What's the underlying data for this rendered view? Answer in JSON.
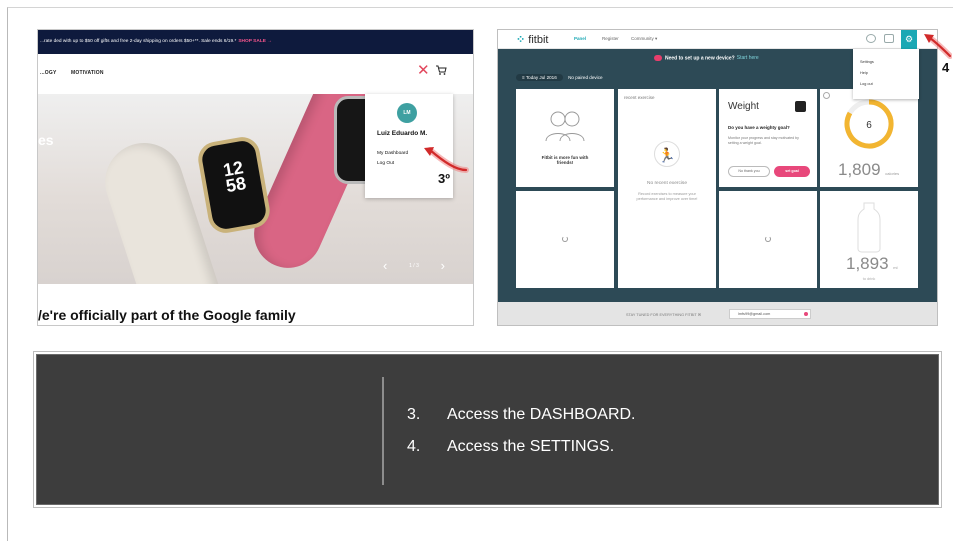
{
  "left_screenshot": {
    "promo_text": "...rate ded with up to $50 off gifts and free 2-day shipping on orders $50+**. Sale ends 6/19.*",
    "promo_link": "SHOP SALE →",
    "nav_items": [
      "...OGY",
      "MOTIVATION"
    ],
    "hero_text": "es",
    "watch_time": "12\n58",
    "carousel_pager": "1 / 3",
    "user_menu": {
      "avatar_initials": "LM",
      "user_name": "Luiz Eduardo M.",
      "links": [
        "My Dashboard",
        "Log Out"
      ]
    },
    "headline": "/e're officially part of the Google family",
    "step_marker": "3º"
  },
  "right_screenshot": {
    "logo": "fitbit",
    "tabs": [
      "Panel",
      "Register",
      "Community ▾"
    ],
    "banner_text": "Need to set up a new device?",
    "banner_link": "Start here",
    "today_label": "Today",
    "today_date": "Jul 2016",
    "paired_label": "No paired device",
    "friends_caption": "Fitbit is more fun with friends!",
    "exercise_title": "recent exercise",
    "exercise_none": "No recent exercise",
    "exercise_desc": "Record exercises to measure your performance and improve over time!",
    "weight": {
      "title": "Weight",
      "question": "Do you have a weighty goal?",
      "desc": "Monitor your progress and stay motivated by setting a weight goal.",
      "btn_no": "No thank you",
      "btn_set": "set goal"
    },
    "calories_value": "1,809",
    "calories_unit": "calories",
    "calories_ring_value": "6",
    "water_value": "1,893",
    "water_unit": "ml",
    "water_caption": "to drink",
    "footer_text": "STAY TUNED FOR EVERYTHING FITBIT ✉",
    "footer_email": "lmfs99@gmail.com",
    "settings_menu": [
      "Settings",
      "Help",
      "Log out"
    ],
    "step_marker": "4"
  },
  "caption": {
    "steps": [
      {
        "num": "3.",
        "text": "Access the DASHBOARD."
      },
      {
        "num": "4.",
        "text": "Access the SETTINGS."
      }
    ]
  },
  "colors": {
    "navy_bar": "#0e1a3d",
    "fitbit_teal": "#1aa8b4",
    "dashboard_bg": "#2d4a56",
    "accent_pink": "#e8487b",
    "caption_bg": "#3d3d3d",
    "arrow_red": "#d12a2a"
  }
}
